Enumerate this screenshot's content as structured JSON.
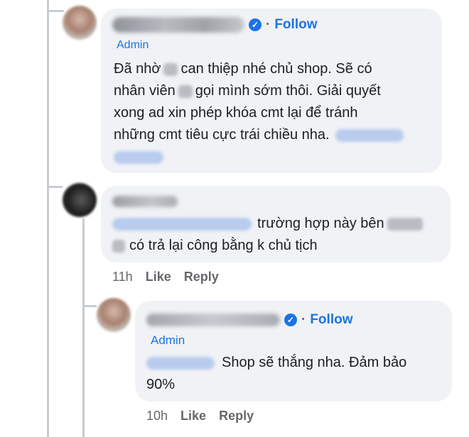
{
  "comment1": {
    "follow_label": "Follow",
    "badge": "Admin",
    "lines": [
      "Đã nhờ",
      "can thiệp nhé chủ shop. Sẽ có",
      "nhân viên",
      "gọi mình sớm thôi. Giải quyết",
      "xong ad xin phép khóa cmt lại để tránh",
      "những cmt tiêu cực trái chiều nha."
    ]
  },
  "comment2": {
    "text_a": "trường hợp này bên",
    "text_b": "có trả lại công bằng k chủ tịch",
    "time": "11h",
    "like_label": "Like",
    "reply_label": "Reply"
  },
  "comment3": {
    "follow_label": "Follow",
    "badge": "Admin",
    "text_a": "Shop sẽ thắng nha. Đảm bảo",
    "text_b": "90%",
    "time": "10h",
    "like_label": "Like",
    "reply_label": "Reply"
  }
}
